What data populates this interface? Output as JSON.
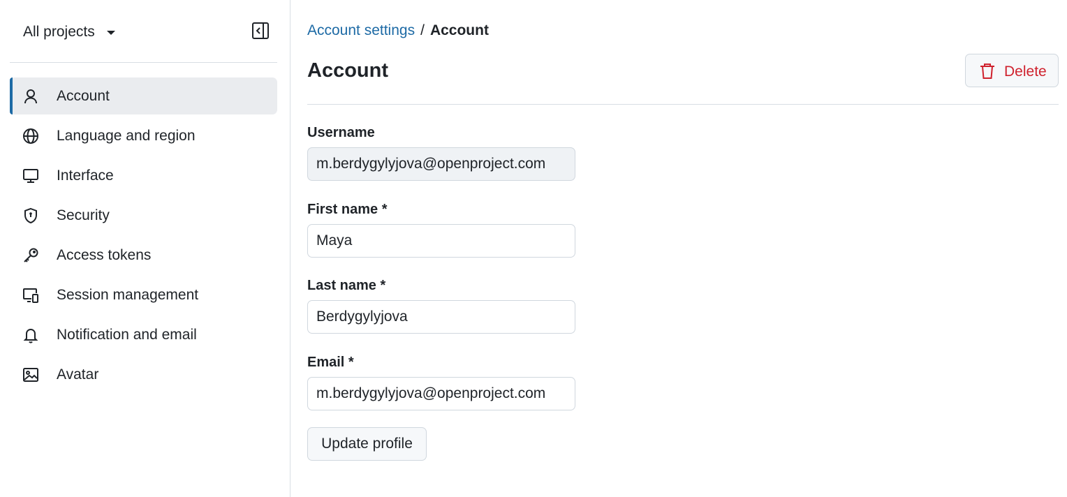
{
  "sidebar": {
    "project_switcher": "All projects",
    "items": [
      {
        "label": "Account",
        "icon": "person-icon",
        "active": true
      },
      {
        "label": "Language and region",
        "icon": "globe-icon"
      },
      {
        "label": "Interface",
        "icon": "monitor-icon"
      },
      {
        "label": "Security",
        "icon": "shield-icon"
      },
      {
        "label": "Access tokens",
        "icon": "key-icon"
      },
      {
        "label": "Session management",
        "icon": "devices-icon"
      },
      {
        "label": "Notification and email",
        "icon": "bell-icon"
      },
      {
        "label": "Avatar",
        "icon": "image-icon"
      }
    ]
  },
  "breadcrumb": {
    "parent": "Account settings",
    "separator": "/",
    "current": "Account"
  },
  "header": {
    "title": "Account",
    "delete_label": "Delete"
  },
  "form": {
    "username": {
      "label": "Username",
      "value": "m.berdygylyjova@openproject.com"
    },
    "first_name": {
      "label": "First name *",
      "value": "Maya"
    },
    "last_name": {
      "label": "Last name *",
      "value": "Berdygylyjova"
    },
    "email": {
      "label": "Email *",
      "value": "m.berdygylyjova@openproject.com"
    },
    "submit_label": "Update profile"
  },
  "colors": {
    "accent": "#1d6aa5",
    "danger": "#cf222e",
    "active_bg": "#eaecef"
  }
}
